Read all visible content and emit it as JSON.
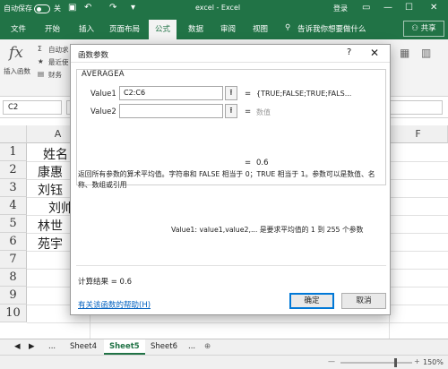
{
  "titlebar": {
    "autosave": "自动保存",
    "autosave_state": "关",
    "window_title": "excel  -  Excel",
    "login": "登录"
  },
  "ribbon_tabs": [
    "文件",
    "开始",
    "插入",
    "页面布局",
    "公式",
    "数据",
    "审阅",
    "视图"
  ],
  "tell_me": "告诉我你想要做什么",
  "share": "共享",
  "ribbon": {
    "insert_function": "插入函数",
    "autosum": "自动求",
    "recent": "最近使",
    "finance": "财务"
  },
  "formula_bar": {
    "name_box": "C2"
  },
  "grid": {
    "col_a": "A",
    "col_f": "F",
    "rows": [
      "1",
      "2",
      "3",
      "4",
      "5",
      "6",
      "7",
      "8",
      "9",
      "10"
    ],
    "cells": [
      "姓名",
      "康惠",
      "刘钰",
      "刘帅",
      "林世",
      "苑宇"
    ]
  },
  "sheets": {
    "more_left": "...",
    "tabs": [
      "Sheet4",
      "Sheet5",
      "Sheet6"
    ],
    "more_right": "...",
    "add": "⊕"
  },
  "status": {
    "zoom": "150%"
  },
  "dialog": {
    "title": "函数参数",
    "help_q": "?",
    "close": "✕",
    "function_name": "AVERAGEA",
    "args": [
      {
        "label": "Value1",
        "input": "C2:C6",
        "eq": "=",
        "value": "{TRUE;FALSE;TRUE;FALS..."
      },
      {
        "label": "Value2",
        "input": "",
        "eq": "=",
        "value": "数值"
      }
    ],
    "result_eq": "=",
    "result_value": "0.6",
    "description": "返回所有参数的算术平均值。字符串和 FALSE 相当于 0；TRUE 相当于 1。参数可以是数值、名称、数组或引用",
    "arg_description": "Value1:  value1,value2,... 是要求平均值的 1 到 255 个参数",
    "calc_result_label": "计算结果 =",
    "calc_result_value": "0.6",
    "help_link": "有关该函数的帮助(H)",
    "ok": "确定",
    "cancel": "取消"
  }
}
